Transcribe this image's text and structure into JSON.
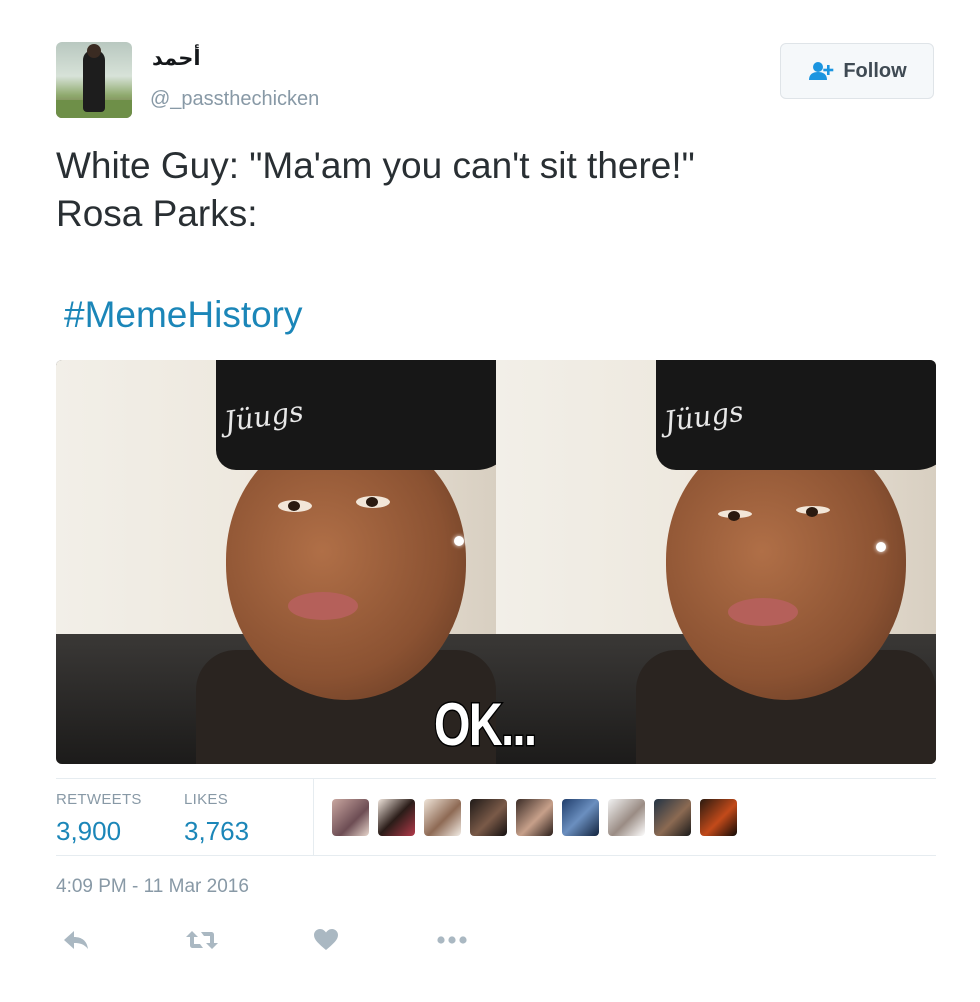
{
  "user": {
    "display_name": "أحمد",
    "handle": "@_passthechicken"
  },
  "follow_button": {
    "label": "Follow"
  },
  "tweet": {
    "lines": [
      "White Guy: \"Ma'am you can't sit there!\"",
      "Rosa Parks:"
    ],
    "hashtag": "#MemeHistory"
  },
  "media": {
    "caption": "OK...",
    "beanie_text": "Jüugs"
  },
  "stats": {
    "retweets_label": "RETWEETS",
    "retweets_value": "3,900",
    "likes_label": "LIKES",
    "likes_value": "3,763"
  },
  "timestamp": "4:09 PM - 11 Mar 2016",
  "actions": {
    "icons": [
      "reply-icon",
      "retweet-icon",
      "like-icon",
      "more-icon"
    ]
  },
  "colors": {
    "link": "#1b86b8",
    "muted": "#8899a6",
    "text": "#292f33"
  }
}
